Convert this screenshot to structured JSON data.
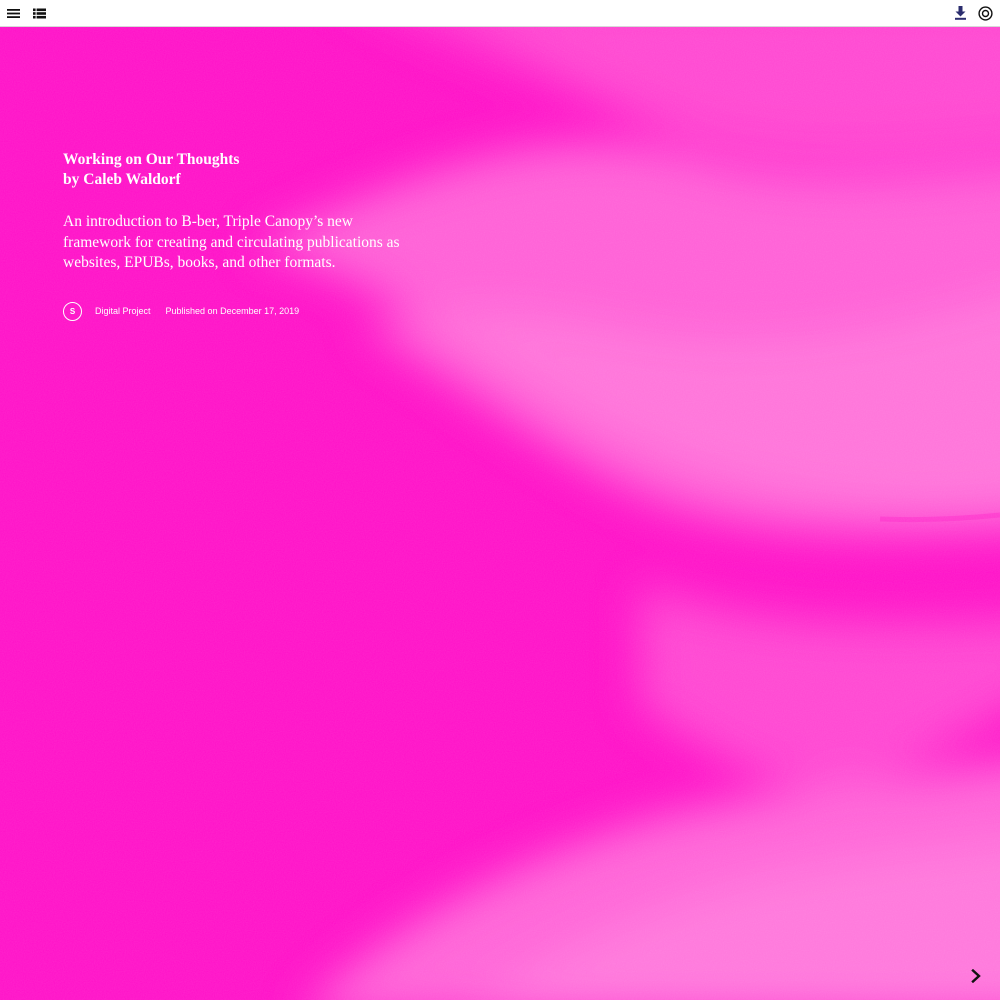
{
  "toolbar": {
    "left_icons": [
      "menu-icon",
      "list-icon"
    ],
    "right_icons": [
      "download-icon",
      "target-icon"
    ],
    "accent_color": "#2b2d6e"
  },
  "hero": {
    "background_color": "#ff10c8",
    "title_line1": "Working on Our Thoughts",
    "title_line2": "by Caleb Waldorf",
    "intro": "An introduction to B-ber, Triple Canopy’s new framework for creating and circulating publications as websites, EPUBs, books, and other formats.",
    "badge_letter": "S",
    "category": "Digital Project",
    "published": "Published on December 17, 2019"
  },
  "navigation": {
    "next_icon": "chevron-right-icon"
  }
}
